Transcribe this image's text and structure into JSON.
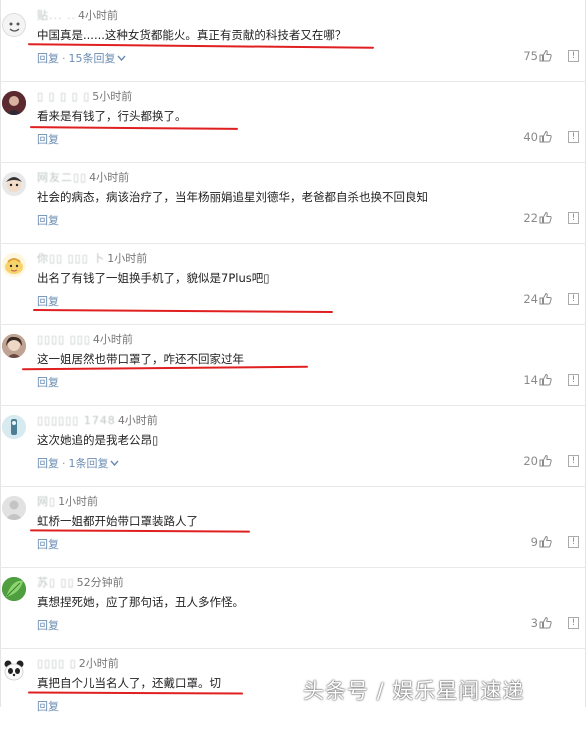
{
  "comments": [
    {
      "user": "贴... ..",
      "time": "4小时前",
      "text": "中国真是......这种女货都能火。真正有贡献的科技者又在哪？",
      "reply": "回复",
      "replies": "15条回复",
      "likes": "75"
    },
    {
      "user": "▯ ▯ ▯ ▯ ▯",
      "time": "5小时前",
      "text": "看来是有钱了，行头都换了。",
      "reply": "回复",
      "replies": "",
      "likes": "40"
    },
    {
      "user": "网友二▯▯",
      "time": "4小时前",
      "text": "社会的病态，病该治疗了，当年杨丽娟追星刘德华，老爸都自杀也换不回良知",
      "reply": "回复",
      "replies": "",
      "likes": "22"
    },
    {
      "user": "你▯▯ ▯▯▯ 卜",
      "time": "1小时前",
      "text": "出名了有钱了一姐换手机了，貌似是7Plus吧▯",
      "reply": "回复",
      "replies": "",
      "likes": "24"
    },
    {
      "user": "▯▯▯▯ ▯▯▯",
      "time": "4小时前",
      "text": "这一姐居然也带口罩了，咋还不回家过年",
      "reply": "回复",
      "replies": "",
      "likes": "14"
    },
    {
      "user": "▯▯▯▯▯▯ 1748",
      "time": "4小时前",
      "text": "这次她追的是我老公昂▯",
      "reply": "回复",
      "replies": "1条回复",
      "likes": "20"
    },
    {
      "user": "网▯",
      "time": "1小时前",
      "text": "虹桥一姐都开始带口罩装路人了",
      "reply": "回复",
      "replies": "",
      "likes": "9"
    },
    {
      "user": "苏▯ ▯▯",
      "time": "52分钟前",
      "text": "真想捏死她，应了那句话，丑人多作怪。",
      "reply": "回复",
      "replies": "",
      "likes": "3"
    },
    {
      "user": "▯▯▯▯ ▯",
      "time": "2小时前",
      "text": "真把自个儿当名人了，还戴口罩。切",
      "reply": "回复",
      "replies": "",
      "likes": "3"
    }
  ],
  "icons": {
    "like": "thumbs-up-icon",
    "report": "report-icon",
    "chevron": "chevron-down-icon"
  },
  "colors": {
    "link": "#6b8db3",
    "highlight": "#e02020"
  },
  "watermark": "头条号 / 娱乐星闻速递"
}
